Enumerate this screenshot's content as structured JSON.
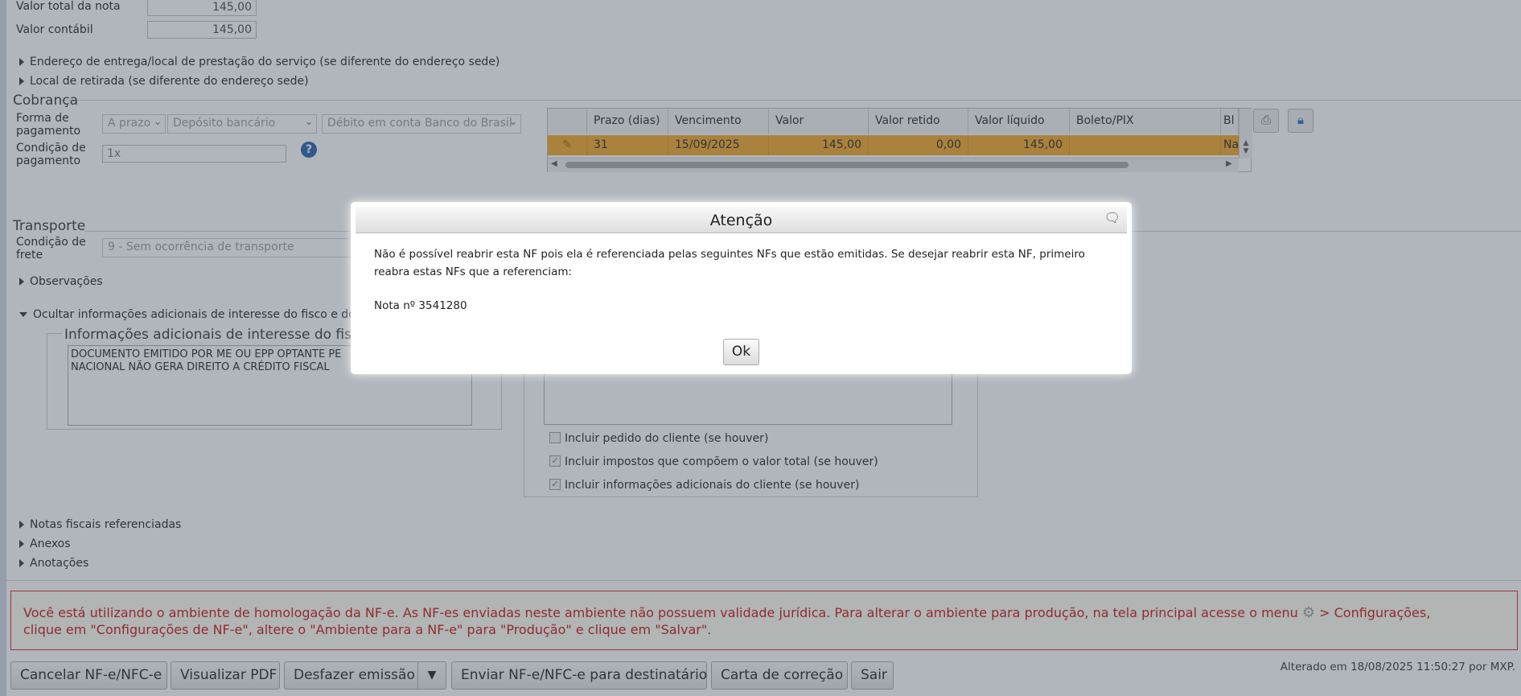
{
  "totals": {
    "valor_total_label": "Valor total da nota",
    "valor_total_value": "145,00",
    "valor_contabil_label": "Valor contábil",
    "valor_contabil_value": "145,00"
  },
  "collapsibles": {
    "endereco_entrega": "Endereço de entrega/local de prestação do serviço (se diferente do endereço sede)",
    "local_retirada": "Local de retirada (se diferente do endereço sede)",
    "observacoes": "Observações",
    "ocultar_info": "Ocultar informações adicionais de interesse do fisco e do co",
    "notas_referenciadas": "Notas fiscais referenciadas",
    "anexos": "Anexos",
    "anotacoes": "Anotações"
  },
  "cobranca": {
    "title": "Cobrança",
    "forma_label_1": "Forma de",
    "forma_label_2": "pagamento",
    "forma_options": [
      "A prazo",
      "Depósito bancário",
      "Débito em conta Banco do Brasil"
    ],
    "condicao_label_1": "Condição de",
    "condicao_label_2": "pagamento",
    "condicao_value": "1x",
    "help_icon": "?"
  },
  "grid": {
    "headers": [
      "Prazo (dias)",
      "Vencimento",
      "Valor",
      "Valor retido",
      "Valor líquido",
      "Boleto/PIX",
      "Bl"
    ],
    "row": [
      "31",
      "15/09/2025",
      "145,00",
      "0,00",
      "145,00",
      "",
      "Na"
    ]
  },
  "transporte": {
    "title": "Transporte",
    "frete_label_1": "Condição de",
    "frete_label_2": "frete",
    "frete_value": "9 - Sem ocorrência de transporte"
  },
  "info_fisco": {
    "title": "Informações adicionais de interesse do fisco",
    "text_line1": "DOCUMENTO EMITIDO POR ME OU EPP OPTANTE PE",
    "text_line2": "NACIONAL NÃO GERA DIREITO A CRÉDITO FISCAL"
  },
  "checkboxes": [
    {
      "label": "Incluir pedido do cliente (se houver)",
      "checked": false
    },
    {
      "label": "Incluir impostos que compõem o valor total (se houver)",
      "checked": true
    },
    {
      "label": "Incluir informações adicionais do cliente (se houver)",
      "checked": true
    }
  ],
  "warning": {
    "line1_a": "Você está utilizando o ambiente de homologação da NF-e. As NF-es enviadas neste ambiente não possuem validade jurídica. Para alterar o ambiente para produção, na tela principal acesse o menu",
    "line1_b": "> Configurações,",
    "line2": "clique em \"Configurações de NF-e\", altere o \"Ambiente para a NF-e\" para \"Produção\" e clique em \"Salvar\"."
  },
  "buttons": {
    "cancelar": "Cancelar NF-e/NFC-e",
    "visualizar": "Visualizar PDF",
    "desfazer": "Desfazer emissão",
    "enviar": "Enviar NF-e/NFC-e para destinatário",
    "carta": "Carta de correção",
    "sair": "Sair"
  },
  "status": {
    "alterado": "Alterado em 18/08/2025 11:50:27 por MXP."
  },
  "modal": {
    "title": "Atenção",
    "message": "Não é possível reabrir esta NF pois ela é referenciada pelas seguintes NFs que estão emitidas. Se desejar reabrir esta NF, primeiro reabra estas NFs que a referenciam:",
    "note": "Nota nº 3541280",
    "ok": "Ok"
  },
  "colors": {
    "grid_row": "#f5a623",
    "warning_text": "#cc1111",
    "overlay": "rgba(70,80,95,0.42)"
  }
}
